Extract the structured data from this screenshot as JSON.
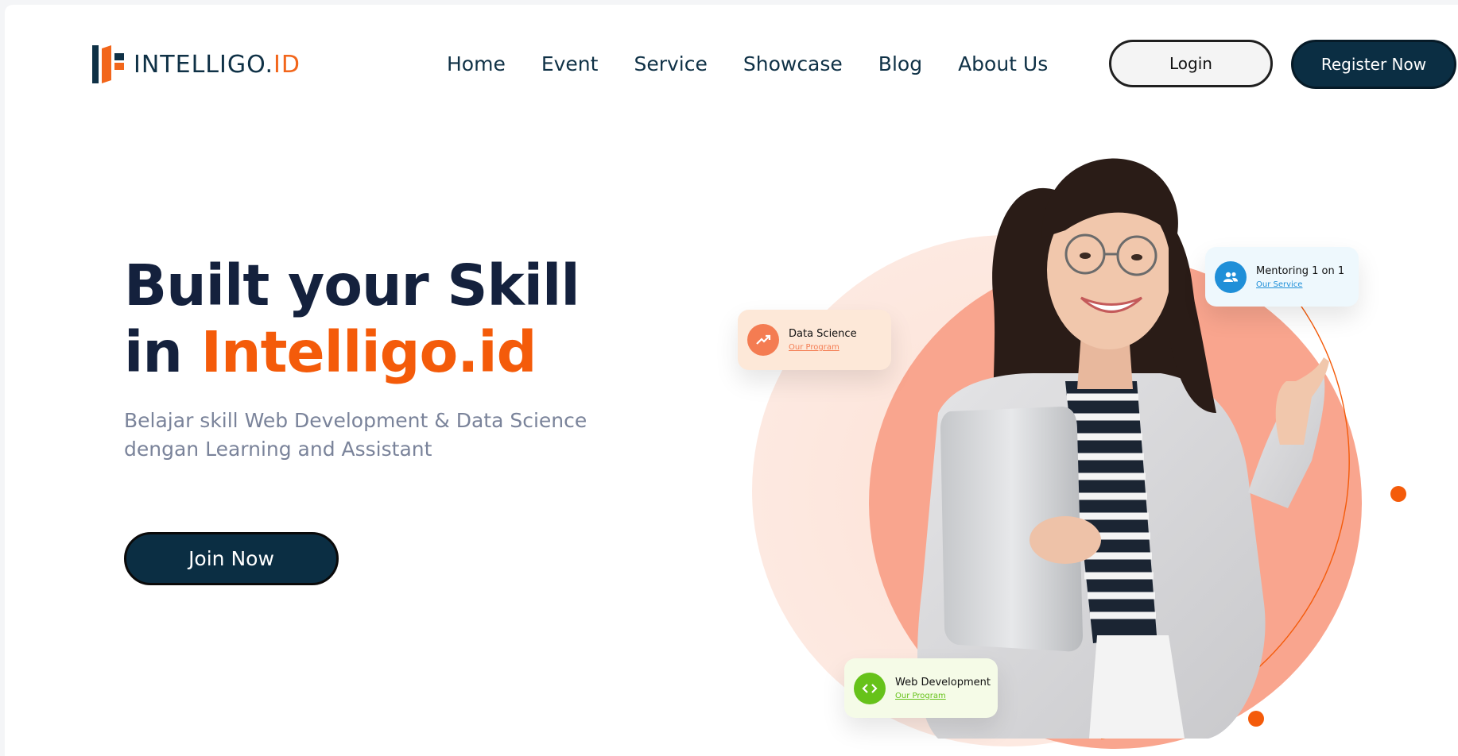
{
  "brand": {
    "name_main": "INTELLIGO.",
    "name_accent": "ID",
    "logo_icon": "intelligo-logo-icon",
    "colors": {
      "navy": "#0b2e43",
      "orange": "#f45b0a",
      "salmon": "#f9a58e"
    }
  },
  "nav": {
    "items": [
      "Home",
      "Event",
      "Service",
      "Showcase",
      "Blog",
      "About Us"
    ]
  },
  "header": {
    "login_label": "Login",
    "register_label": "Register Now"
  },
  "hero": {
    "title_line1": "Built your Skill",
    "title_line2_prefix": "in ",
    "title_line2_accent": "Intelligo.id",
    "subtitle": "Belajar skill Web Development & Data Science dengan Learning and Assistant",
    "cta_label": "Join Now"
  },
  "cards": {
    "data_science": {
      "title": "Data Science",
      "link": "Our Program",
      "icon": "trending-up-icon"
    },
    "mentoring": {
      "title": "Mentoring 1 on 1",
      "link": "Our Service",
      "icon": "users-icon"
    },
    "web_dev": {
      "title": "Web Development",
      "link": "Our Program",
      "icon": "code-icon"
    }
  }
}
